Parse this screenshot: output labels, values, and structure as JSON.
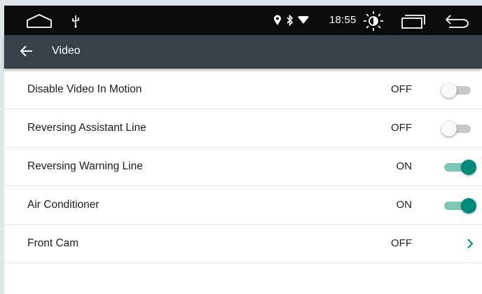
{
  "status_bar": {
    "time": "18:55",
    "icons": [
      "home-icon",
      "usb-icon",
      "location-icon",
      "bluetooth-icon",
      "wifi-icon",
      "brightness-icon",
      "recents-icon",
      "back-nav-icon"
    ]
  },
  "app_bar": {
    "title": "Video",
    "back_icon": "arrow-left-icon"
  },
  "settings": [
    {
      "label": "Disable Video In Motion",
      "value": "OFF",
      "control": "toggle",
      "on": false
    },
    {
      "label": "Reversing Assistant Line",
      "value": "OFF",
      "control": "toggle",
      "on": false
    },
    {
      "label": "Reversing Warning Line",
      "value": "ON",
      "control": "toggle",
      "on": true
    },
    {
      "label": "Air Conditioner",
      "value": "ON",
      "control": "toggle",
      "on": true
    },
    {
      "label": "Front Cam",
      "value": "OFF",
      "control": "chevron"
    }
  ],
  "colors": {
    "status_bar": "#0b0b0b",
    "app_bar": "#37414a",
    "accent": "#00897b",
    "accent_track": "#7cc7b7",
    "off_track": "#c8c8c8"
  }
}
